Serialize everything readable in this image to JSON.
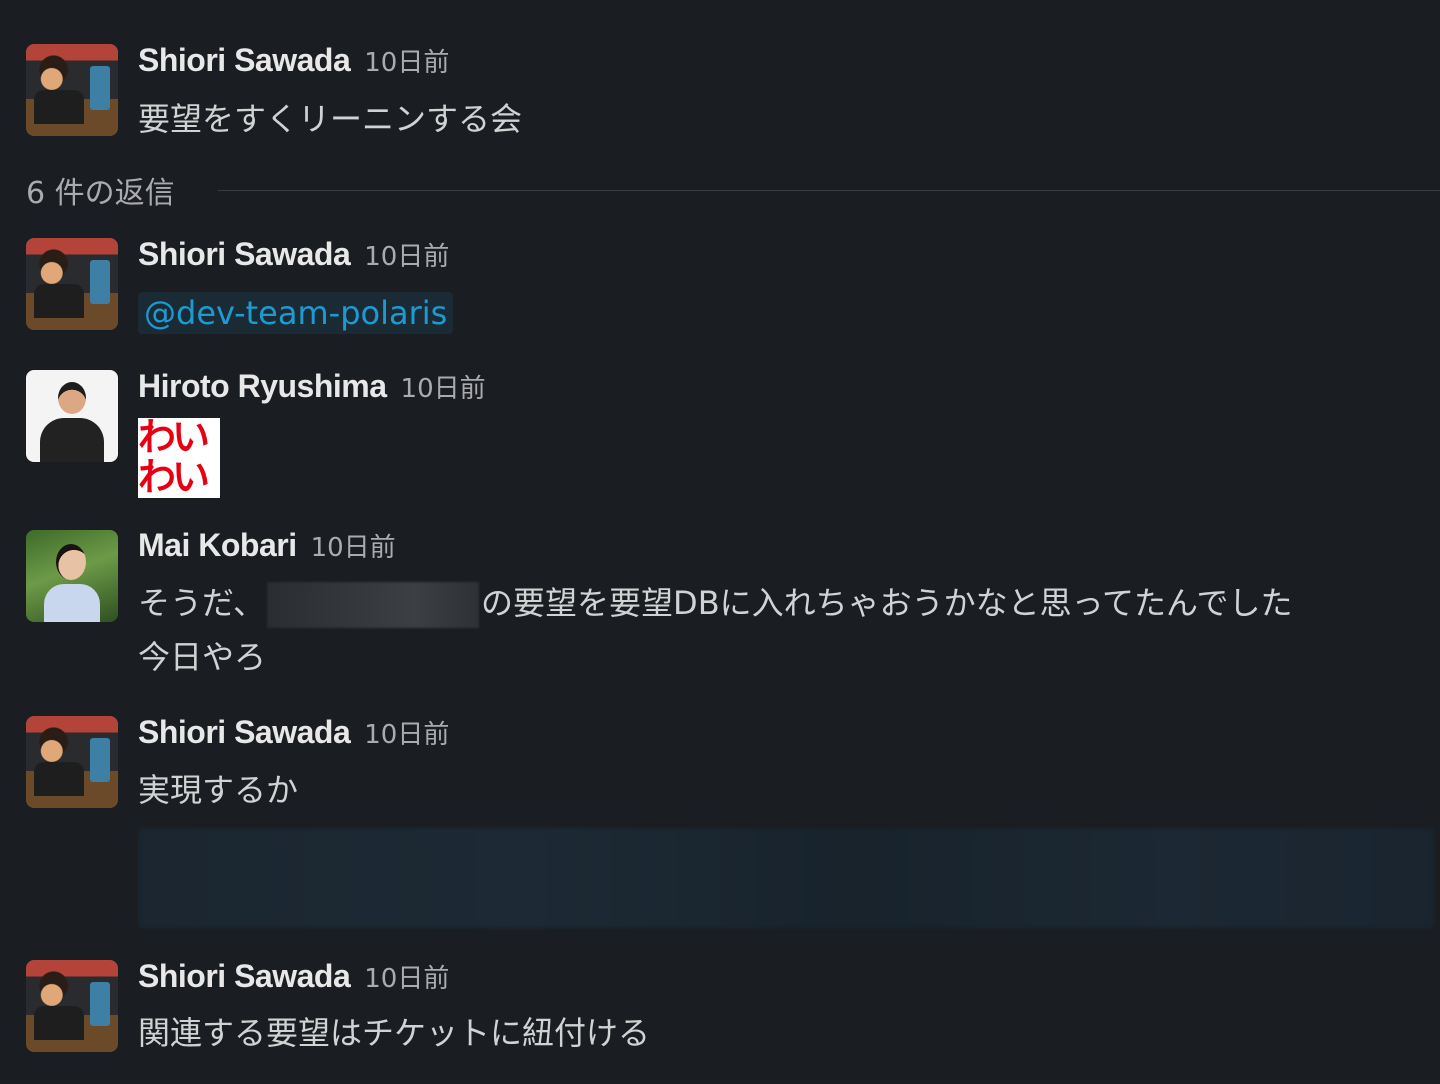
{
  "parent": {
    "author": "Shiori Sawada",
    "time": "10日前",
    "text": "要望をすくリーニンする会"
  },
  "replies_divider": {
    "label": "6 件の返信"
  },
  "replies": [
    {
      "author": "Shiori Sawada",
      "time": "10日前",
      "mention": "@dev-team-polaris"
    },
    {
      "author": "Hiroto Ryushima",
      "time": "10日前",
      "emoji_text_line1": "わい",
      "emoji_text_line2": "わい"
    },
    {
      "author": "Mai Kobari",
      "time": "10日前",
      "text_line1_prefix": "そうだ、",
      "text_line1_suffix": "の要望を要望DBに入れちゃおうかなと思ってたんでした",
      "text_line2": "今日やろ"
    },
    {
      "author": "Shiori Sawada",
      "time": "10日前",
      "text": "実現するか"
    },
    {
      "author": "Shiori Sawada",
      "time": "10日前",
      "text": "関連する要望はチケットに紐付ける"
    }
  ]
}
